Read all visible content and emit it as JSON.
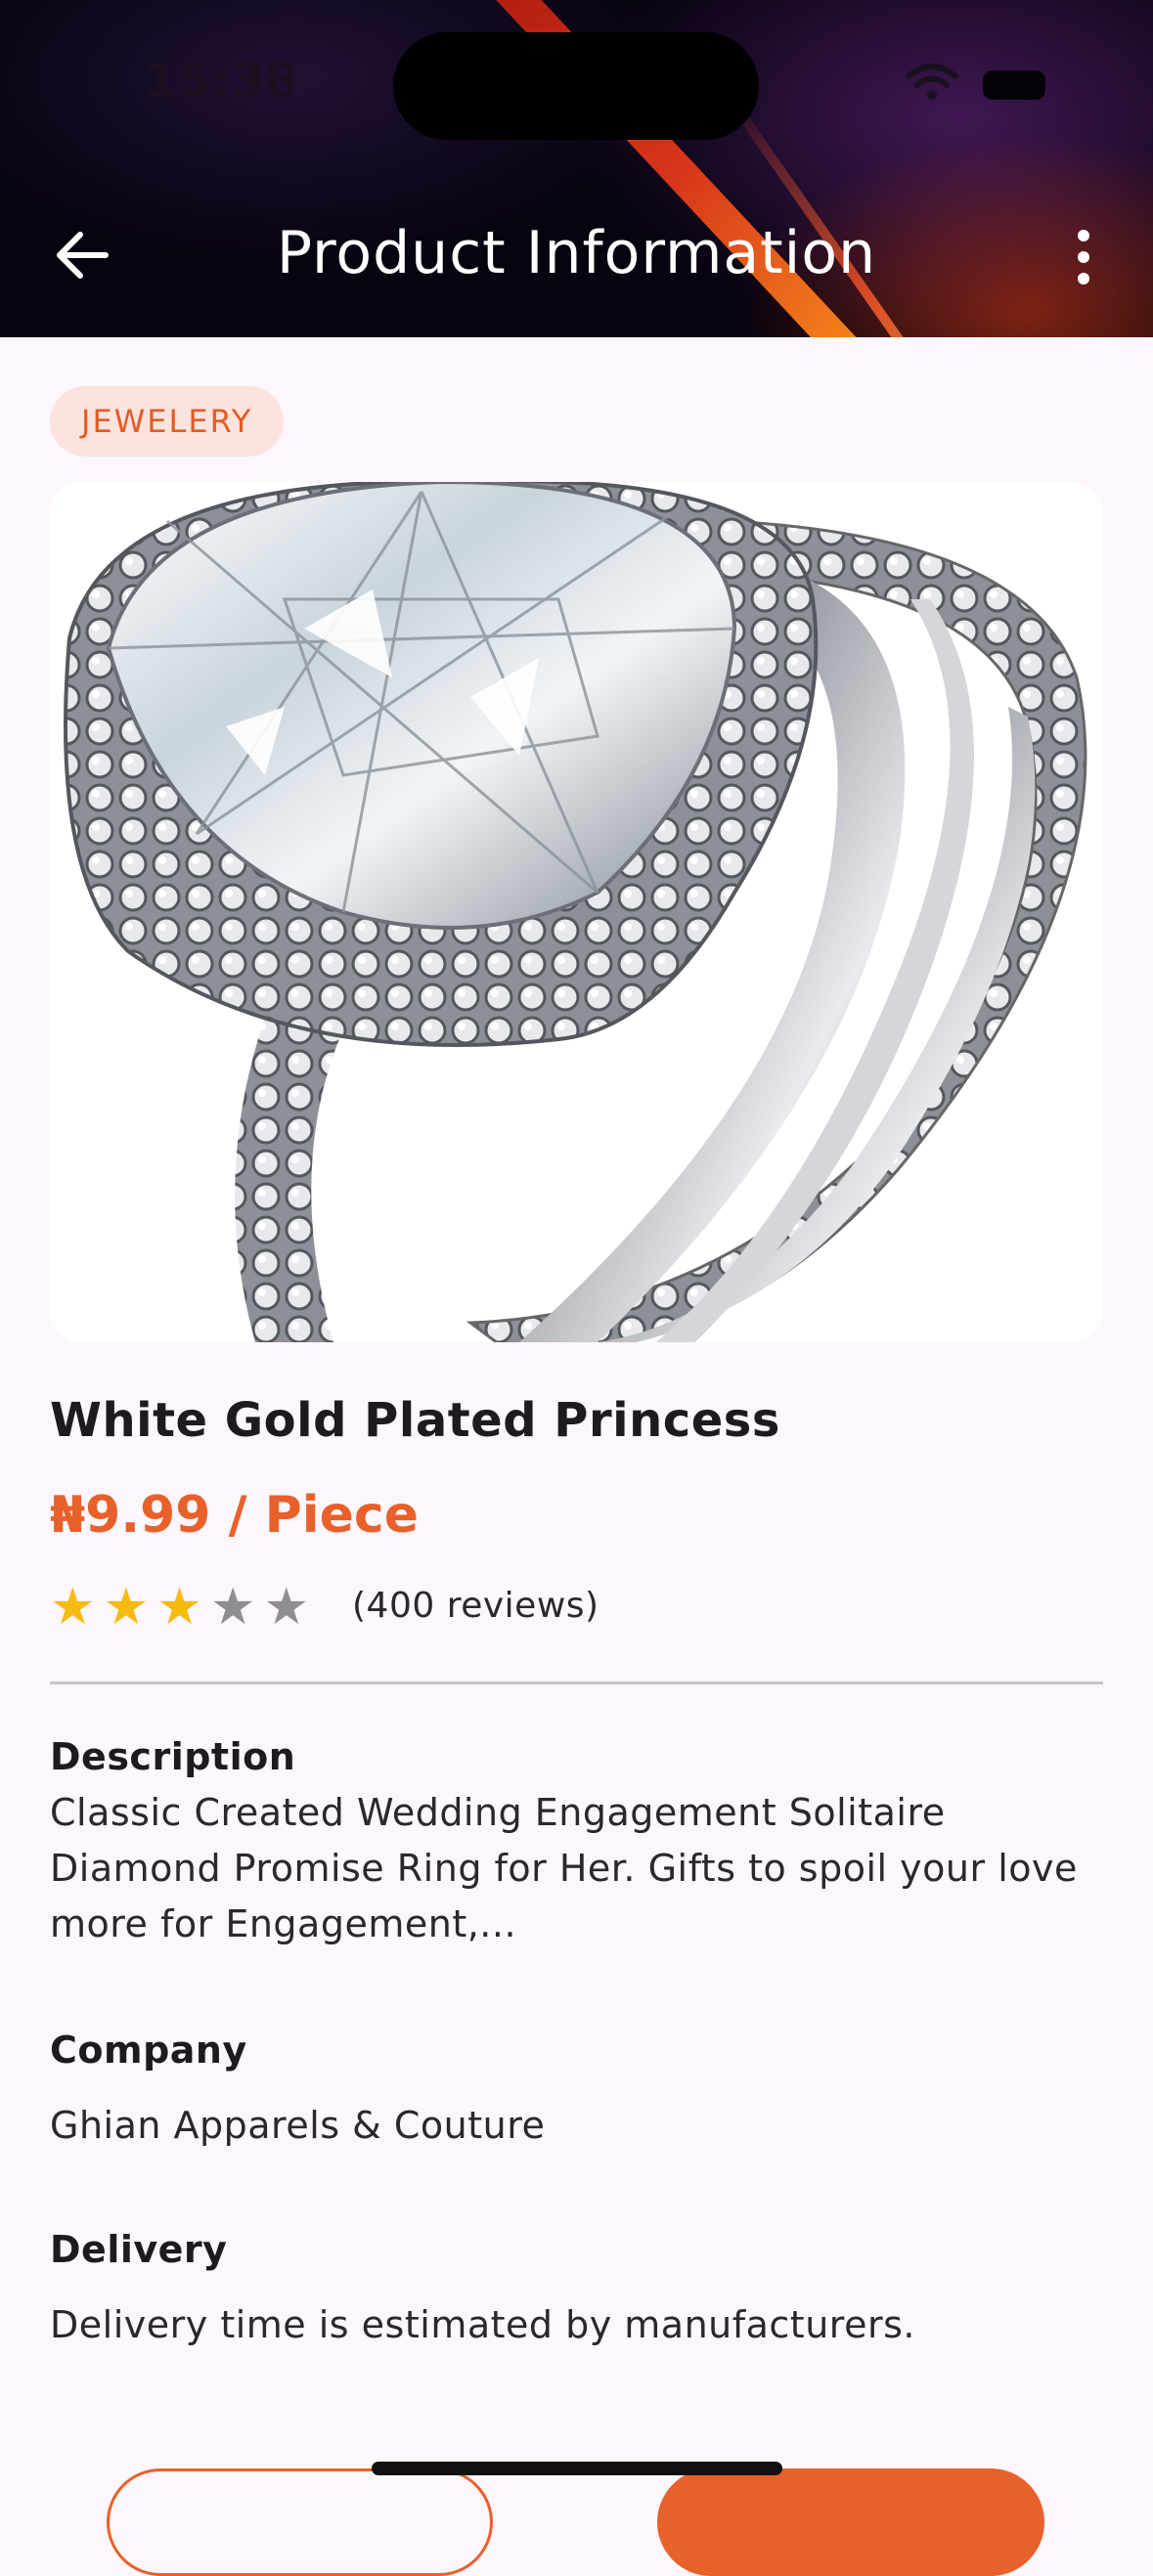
{
  "status_bar": {
    "time": "15:38"
  },
  "header": {
    "title": "Product Information"
  },
  "product": {
    "category": "JEWELERY",
    "name": "White Gold Plated Princess",
    "price": "₦9.99 / Piece",
    "rating": 3,
    "rating_max": 5,
    "reviews": "(400 reviews)",
    "description_label": "Description",
    "description": "Classic Created Wedding Engagement Solitaire Diamond Promise Ring for Her. Gifts to spoil your love more for Engagement,...",
    "company_label": "Company",
    "company": "Ghian Apparels & Couture",
    "delivery_label": "Delivery",
    "delivery": "Delivery time is estimated by manufacturers."
  },
  "colors": {
    "accent": "#e8602a",
    "chip_bg": "#fce3de",
    "star_on": "#f6bb10",
    "star_off": "#8f8d92",
    "page_bg": "#fdf6fc"
  },
  "icons": {
    "back": "arrow-left-icon",
    "more": "more-vertical-icon",
    "star": "star-icon"
  }
}
